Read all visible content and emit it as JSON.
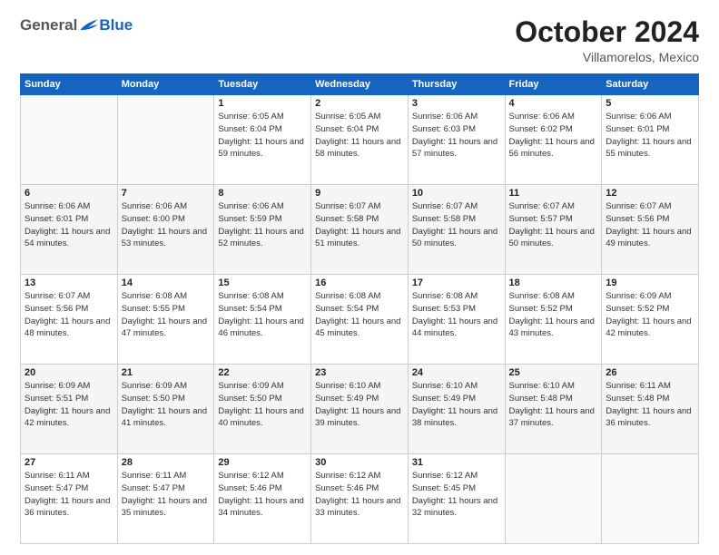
{
  "header": {
    "logo_general": "General",
    "logo_blue": "Blue",
    "month_title": "October 2024",
    "location": "Villamorelos, Mexico"
  },
  "weekdays": [
    "Sunday",
    "Monday",
    "Tuesday",
    "Wednesday",
    "Thursday",
    "Friday",
    "Saturday"
  ],
  "weeks": [
    [
      {
        "day": "",
        "info": ""
      },
      {
        "day": "",
        "info": ""
      },
      {
        "day": "1",
        "info": "Sunrise: 6:05 AM\nSunset: 6:04 PM\nDaylight: 11 hours and 59 minutes."
      },
      {
        "day": "2",
        "info": "Sunrise: 6:05 AM\nSunset: 6:04 PM\nDaylight: 11 hours and 58 minutes."
      },
      {
        "day": "3",
        "info": "Sunrise: 6:06 AM\nSunset: 6:03 PM\nDaylight: 11 hours and 57 minutes."
      },
      {
        "day": "4",
        "info": "Sunrise: 6:06 AM\nSunset: 6:02 PM\nDaylight: 11 hours and 56 minutes."
      },
      {
        "day": "5",
        "info": "Sunrise: 6:06 AM\nSunset: 6:01 PM\nDaylight: 11 hours and 55 minutes."
      }
    ],
    [
      {
        "day": "6",
        "info": "Sunrise: 6:06 AM\nSunset: 6:01 PM\nDaylight: 11 hours and 54 minutes."
      },
      {
        "day": "7",
        "info": "Sunrise: 6:06 AM\nSunset: 6:00 PM\nDaylight: 11 hours and 53 minutes."
      },
      {
        "day": "8",
        "info": "Sunrise: 6:06 AM\nSunset: 5:59 PM\nDaylight: 11 hours and 52 minutes."
      },
      {
        "day": "9",
        "info": "Sunrise: 6:07 AM\nSunset: 5:58 PM\nDaylight: 11 hours and 51 minutes."
      },
      {
        "day": "10",
        "info": "Sunrise: 6:07 AM\nSunset: 5:58 PM\nDaylight: 11 hours and 50 minutes."
      },
      {
        "day": "11",
        "info": "Sunrise: 6:07 AM\nSunset: 5:57 PM\nDaylight: 11 hours and 50 minutes."
      },
      {
        "day": "12",
        "info": "Sunrise: 6:07 AM\nSunset: 5:56 PM\nDaylight: 11 hours and 49 minutes."
      }
    ],
    [
      {
        "day": "13",
        "info": "Sunrise: 6:07 AM\nSunset: 5:56 PM\nDaylight: 11 hours and 48 minutes."
      },
      {
        "day": "14",
        "info": "Sunrise: 6:08 AM\nSunset: 5:55 PM\nDaylight: 11 hours and 47 minutes."
      },
      {
        "day": "15",
        "info": "Sunrise: 6:08 AM\nSunset: 5:54 PM\nDaylight: 11 hours and 46 minutes."
      },
      {
        "day": "16",
        "info": "Sunrise: 6:08 AM\nSunset: 5:54 PM\nDaylight: 11 hours and 45 minutes."
      },
      {
        "day": "17",
        "info": "Sunrise: 6:08 AM\nSunset: 5:53 PM\nDaylight: 11 hours and 44 minutes."
      },
      {
        "day": "18",
        "info": "Sunrise: 6:08 AM\nSunset: 5:52 PM\nDaylight: 11 hours and 43 minutes."
      },
      {
        "day": "19",
        "info": "Sunrise: 6:09 AM\nSunset: 5:52 PM\nDaylight: 11 hours and 42 minutes."
      }
    ],
    [
      {
        "day": "20",
        "info": "Sunrise: 6:09 AM\nSunset: 5:51 PM\nDaylight: 11 hours and 42 minutes."
      },
      {
        "day": "21",
        "info": "Sunrise: 6:09 AM\nSunset: 5:50 PM\nDaylight: 11 hours and 41 minutes."
      },
      {
        "day": "22",
        "info": "Sunrise: 6:09 AM\nSunset: 5:50 PM\nDaylight: 11 hours and 40 minutes."
      },
      {
        "day": "23",
        "info": "Sunrise: 6:10 AM\nSunset: 5:49 PM\nDaylight: 11 hours and 39 minutes."
      },
      {
        "day": "24",
        "info": "Sunrise: 6:10 AM\nSunset: 5:49 PM\nDaylight: 11 hours and 38 minutes."
      },
      {
        "day": "25",
        "info": "Sunrise: 6:10 AM\nSunset: 5:48 PM\nDaylight: 11 hours and 37 minutes."
      },
      {
        "day": "26",
        "info": "Sunrise: 6:11 AM\nSunset: 5:48 PM\nDaylight: 11 hours and 36 minutes."
      }
    ],
    [
      {
        "day": "27",
        "info": "Sunrise: 6:11 AM\nSunset: 5:47 PM\nDaylight: 11 hours and 36 minutes."
      },
      {
        "day": "28",
        "info": "Sunrise: 6:11 AM\nSunset: 5:47 PM\nDaylight: 11 hours and 35 minutes."
      },
      {
        "day": "29",
        "info": "Sunrise: 6:12 AM\nSunset: 5:46 PM\nDaylight: 11 hours and 34 minutes."
      },
      {
        "day": "30",
        "info": "Sunrise: 6:12 AM\nSunset: 5:46 PM\nDaylight: 11 hours and 33 minutes."
      },
      {
        "day": "31",
        "info": "Sunrise: 6:12 AM\nSunset: 5:45 PM\nDaylight: 11 hours and 32 minutes."
      },
      {
        "day": "",
        "info": ""
      },
      {
        "day": "",
        "info": ""
      }
    ]
  ]
}
